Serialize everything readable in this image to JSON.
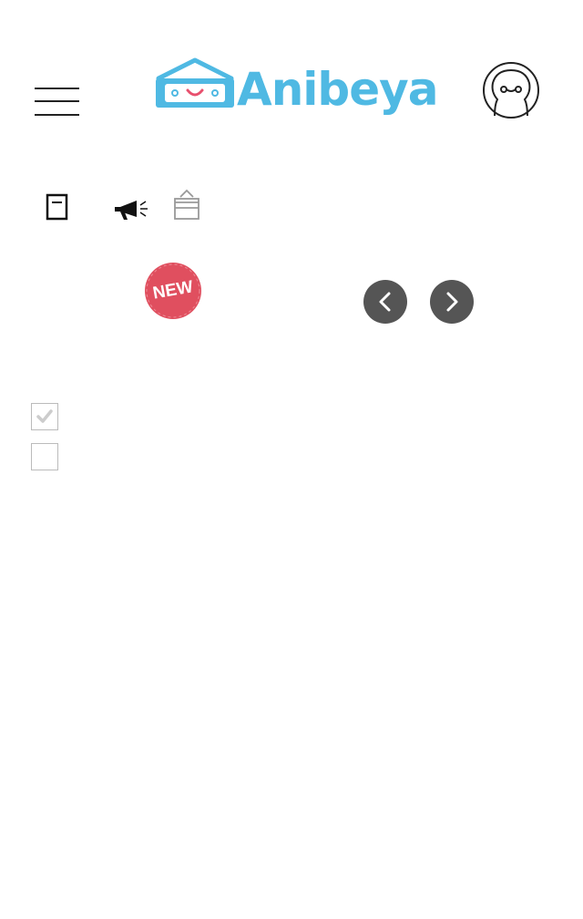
{
  "header": {
    "logo_text": "Anibeya",
    "logo_colors": {
      "text": "#4fb9e3",
      "heart": "#e8506e"
    }
  },
  "nav_icons": [
    {
      "name": "book-icon"
    },
    {
      "name": "megaphone-icon"
    },
    {
      "name": "ballot-box-icon"
    }
  ],
  "badge": {
    "label": "NEW",
    "color": "#e04f5f"
  },
  "carousel": {
    "prev_icon": "chevron-left-icon",
    "next_icon": "chevron-right-icon",
    "button_color": "#555555"
  },
  "checkboxes": [
    {
      "checked": true
    },
    {
      "checked": false
    }
  ]
}
